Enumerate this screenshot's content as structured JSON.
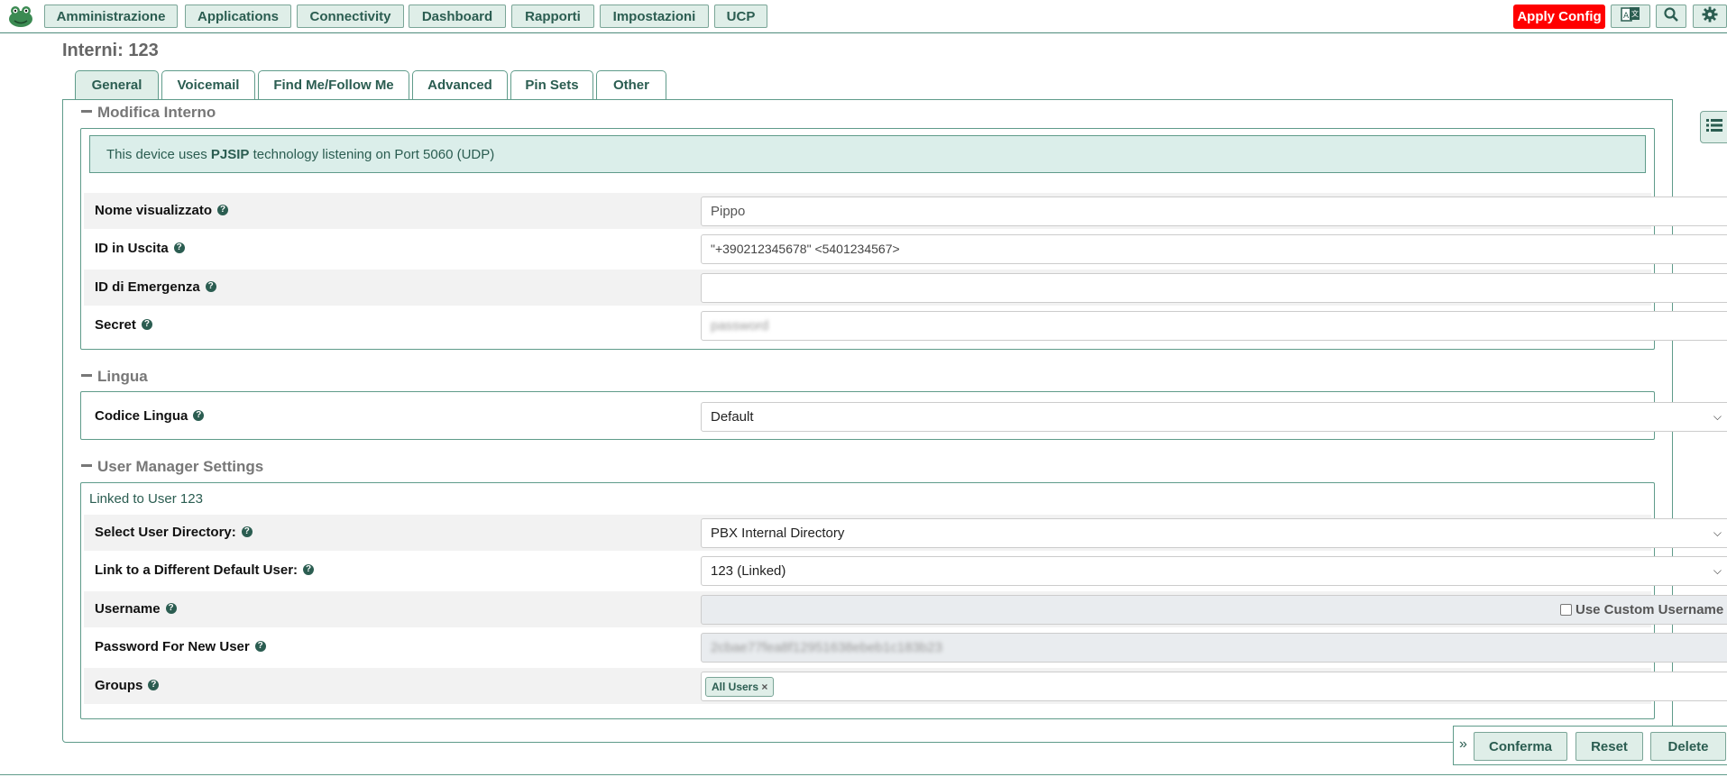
{
  "nav": {
    "items": [
      "Amministrazione",
      "Applications",
      "Connectivity",
      "Dashboard",
      "Rapporti",
      "Impostazioni",
      "UCP"
    ],
    "apply_label": "Apply Config"
  },
  "page": {
    "title": "Interni: 123"
  },
  "tabs": [
    "General",
    "Voicemail",
    "Find Me/Follow Me",
    "Advanced",
    "Pin Sets",
    "Other"
  ],
  "sections": {
    "modifica": {
      "title": "Modifica Interno",
      "info_prefix": "This device uses ",
      "info_tech": "PJSIP",
      "info_suffix": " technology listening on Port 5060 (UDP)",
      "fields": [
        {
          "label": "Nome visualizzato",
          "value": "Pippo"
        },
        {
          "label": "ID in Uscita",
          "value": "\"+390212345678\" <5401234567>"
        },
        {
          "label": "ID di Emergenza",
          "value": ""
        },
        {
          "label": "Secret",
          "value": "password"
        }
      ]
    },
    "lingua": {
      "title": "Lingua",
      "field_label": "Codice Lingua",
      "value": "Default"
    },
    "usermanager": {
      "title": "User Manager Settings",
      "linked_text": "Linked to User 123",
      "directory_label": "Select User Directory:",
      "directory_value": "PBX Internal Directory",
      "link_label": "Link to a Different Default User:",
      "link_value": "123 (Linked)",
      "username_label": "Username",
      "custom_username_label": "Use Custom Username",
      "password_label": "Password For New User",
      "password_value": "2cbae77fea8f12951638ebeb1c183b23",
      "groups_label": "Groups",
      "group_chip": "All Users",
      "chip_remove": "×"
    }
  },
  "actions": {
    "expand": "»",
    "submit": "Conferma",
    "reset": "Reset",
    "delete": "Delete"
  },
  "colors": {
    "accent": "#2b5d51",
    "button_bg": "#dfeee8",
    "apply": "#ff0000"
  }
}
